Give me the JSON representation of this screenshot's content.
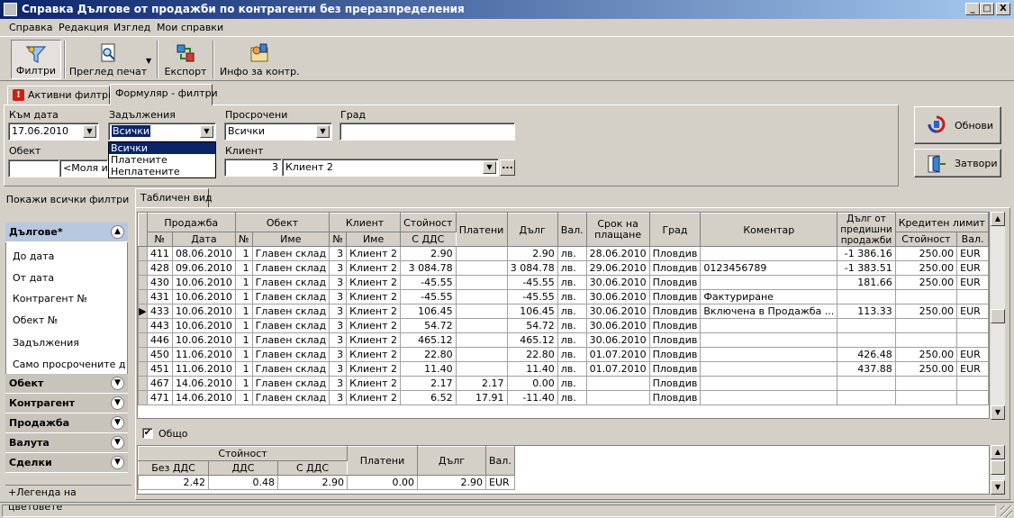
{
  "window": {
    "title": "Справка Дългове от продажби по контрагенти без преразпределения",
    "minimize": "_",
    "maximize": "□",
    "close": "X"
  },
  "menu": [
    "Справка",
    "Редакция",
    "Изглед",
    "Мои справки"
  ],
  "toolbar": {
    "filters": "Филтри",
    "print_preview": "Преглед печат",
    "export": "Експорт",
    "info": "Инфо за контр."
  },
  "tabs": {
    "active_filters": "Активни филтри",
    "form_filters": "Формуляр - филтри",
    "active_icon": "!"
  },
  "form": {
    "to_date_label": "Към дата",
    "to_date": "17.06.2010",
    "obligations_label": "Задължения",
    "obligations": "Всички",
    "obligations_options": [
      "Всички",
      "Платените",
      "Неплатените"
    ],
    "overdue_label": "Просрочени",
    "overdue": "Всички",
    "city_label": "Град",
    "city": "",
    "object_label": "Обект",
    "object_code": "",
    "object_name": "<Моля изб",
    "client_label": "Клиент",
    "client_code": "3",
    "client_name": "Клиент 2",
    "client_more": "..."
  },
  "buttons": {
    "refresh": "Обнови",
    "close": "Затвори"
  },
  "left_panel": {
    "show_all": "Покажи всички филтри",
    "groups": [
      {
        "label": "Дългове*",
        "expanded": true,
        "items": [
          "До дата",
          "От дата",
          "Контрагент №",
          "Обект №",
          "Задължения",
          "Само просрочените дълг"
        ]
      },
      {
        "label": "Обект",
        "expanded": false
      },
      {
        "label": "Контрагент",
        "expanded": false
      },
      {
        "label": "Продажба",
        "expanded": false
      },
      {
        "label": "Валута",
        "expanded": false
      },
      {
        "label": "Сделки",
        "expanded": false
      }
    ],
    "legend": "+Легенда на цветовете"
  },
  "table_tab": "Табличен вид",
  "table": {
    "group_headers": {
      "sale": "Продажба",
      "object": "Обект",
      "client": "Клиент",
      "value": "Стойност",
      "paid": "Платени",
      "debt": "Дълг",
      "currency": "Вал.",
      "due": "Срок на плащане",
      "city": "Град",
      "comment": "Коментар",
      "prev_debt": "Дълг от предишни продажби",
      "credit": "Кредитен лимит"
    },
    "sub_headers": {
      "no": "№",
      "date": "Дата",
      "obj_no": "№",
      "obj_name": "Име",
      "cl_no": "№",
      "cl_name": "Име",
      "vat": "С ДДС",
      "credit_value": "Стойност",
      "credit_cur": "Вал."
    },
    "rows": [
      {
        "no": "411",
        "date": "08.06.2010",
        "obj_no": "1",
        "obj": "Главен склад",
        "cl_no": "3",
        "cl": "Клиент 2",
        "value": "2.90",
        "paid": "",
        "debt": "2.90",
        "cur": "лв.",
        "due": "28.06.2010",
        "city": "Пловдив",
        "comment": "",
        "prev": "-1 386.16",
        "limit": "250.00",
        "lcur": "EUR",
        "current": false
      },
      {
        "no": "428",
        "date": "09.06.2010",
        "obj_no": "1",
        "obj": "Главен склад",
        "cl_no": "3",
        "cl": "Клиент 2",
        "value": "3 084.78",
        "paid": "",
        "debt": "3 084.78",
        "cur": "лв.",
        "due": "29.06.2010",
        "city": "Пловдив",
        "comment": "0123456789",
        "prev": "-1 383.51",
        "limit": "250.00",
        "lcur": "EUR",
        "current": false
      },
      {
        "no": "430",
        "date": "10.06.2010",
        "obj_no": "1",
        "obj": "Главен склад",
        "cl_no": "3",
        "cl": "Клиент 2",
        "value": "-45.55",
        "paid": "",
        "debt": "-45.55",
        "cur": "лв.",
        "due": "30.06.2010",
        "city": "Пловдив",
        "comment": "",
        "prev": "181.66",
        "limit": "250.00",
        "lcur": "EUR",
        "current": false
      },
      {
        "no": "431",
        "date": "10.06.2010",
        "obj_no": "1",
        "obj": "Главен склад",
        "cl_no": "3",
        "cl": "Клиент 2",
        "value": "-45.55",
        "paid": "",
        "debt": "-45.55",
        "cur": "лв.",
        "due": "30.06.2010",
        "city": "Пловдив",
        "comment": "Фактуриране",
        "prev": "",
        "limit": "",
        "lcur": "",
        "current": false
      },
      {
        "no": "433",
        "date": "10.06.2010",
        "obj_no": "1",
        "obj": "Главен склад",
        "cl_no": "3",
        "cl": "Клиент 2",
        "value": "106.45",
        "paid": "",
        "debt": "106.45",
        "cur": "лв.",
        "due": "30.06.2010",
        "city": "Пловдив",
        "comment": "Включена в Продажба ...",
        "prev": "113.33",
        "limit": "250.00",
        "lcur": "EUR",
        "current": true
      },
      {
        "no": "443",
        "date": "10.06.2010",
        "obj_no": "1",
        "obj": "Главен склад",
        "cl_no": "3",
        "cl": "Клиент 2",
        "value": "54.72",
        "paid": "",
        "debt": "54.72",
        "cur": "лв.",
        "due": "30.06.2010",
        "city": "Пловдив",
        "comment": "",
        "prev": "",
        "limit": "",
        "lcur": "",
        "current": false
      },
      {
        "no": "446",
        "date": "10.06.2010",
        "obj_no": "1",
        "obj": "Главен склад",
        "cl_no": "3",
        "cl": "Клиент 2",
        "value": "465.12",
        "paid": "",
        "debt": "465.12",
        "cur": "лв.",
        "due": "30.06.2010",
        "city": "Пловдив",
        "comment": "",
        "prev": "",
        "limit": "",
        "lcur": "",
        "current": false
      },
      {
        "no": "450",
        "date": "11.06.2010",
        "obj_no": "1",
        "obj": "Главен склад",
        "cl_no": "3",
        "cl": "Клиент 2",
        "value": "22.80",
        "paid": "",
        "debt": "22.80",
        "cur": "лв.",
        "due": "01.07.2010",
        "city": "Пловдив",
        "comment": "",
        "prev": "426.48",
        "limit": "250.00",
        "lcur": "EUR",
        "current": false
      },
      {
        "no": "451",
        "date": "11.06.2010",
        "obj_no": "1",
        "obj": "Главен склад",
        "cl_no": "3",
        "cl": "Клиент 2",
        "value": "11.40",
        "paid": "",
        "debt": "11.40",
        "cur": "лв.",
        "due": "01.07.2010",
        "city": "Пловдив",
        "comment": "",
        "prev": "437.88",
        "limit": "250.00",
        "lcur": "EUR",
        "current": false
      },
      {
        "no": "467",
        "date": "14.06.2010",
        "obj_no": "1",
        "obj": "Главен склад",
        "cl_no": "3",
        "cl": "Клиент 2",
        "value": "2.17",
        "paid": "2.17",
        "debt": "0.00",
        "cur": "лв.",
        "due": "",
        "city": "Пловдив",
        "comment": "",
        "prev": "",
        "limit": "",
        "lcur": "",
        "current": false
      },
      {
        "no": "471",
        "date": "14.06.2010",
        "obj_no": "1",
        "obj": "Главен склад",
        "cl_no": "3",
        "cl": "Клиент 2",
        "value": "6.52",
        "paid": "17.91",
        "debt": "-11.40",
        "cur": "лв.",
        "due": "",
        "city": "Пловдив",
        "comment": "",
        "prev": "",
        "limit": "",
        "lcur": "",
        "current": false
      }
    ]
  },
  "total": {
    "label": "Общо",
    "checked": "✔",
    "headers": {
      "value": "Стойност",
      "no_vat": "Без ДДС",
      "vat": "ДДС",
      "with_vat": "С ДДС",
      "paid": "Платени",
      "debt": "Дълг",
      "cur": "Вал."
    },
    "values": {
      "no_vat": "2.42",
      "vat": "0.48",
      "with_vat": "2.90",
      "paid": "0.00",
      "debt": "2.90",
      "cur": "EUR"
    }
  }
}
